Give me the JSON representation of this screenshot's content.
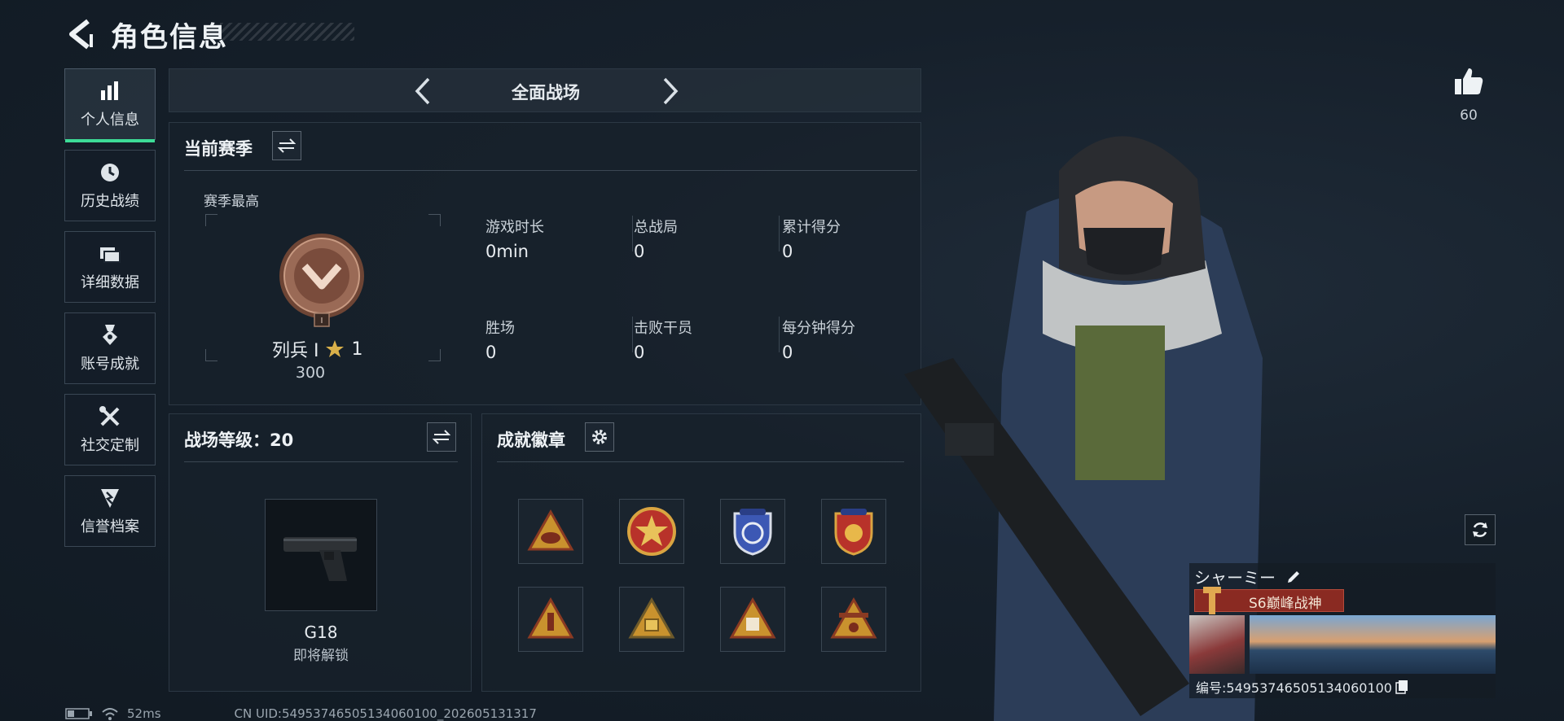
{
  "header": {
    "title": "角色信息"
  },
  "sidebar": {
    "items": [
      {
        "label": "个人信息",
        "icon": "bar-chart-icon",
        "active": true
      },
      {
        "label": "历史战绩",
        "icon": "history-icon",
        "active": false
      },
      {
        "label": "详细数据",
        "icon": "folder-icon",
        "active": false
      },
      {
        "label": "账号成就",
        "icon": "medal-icon",
        "active": false
      },
      {
        "label": "社交定制",
        "icon": "tools-icon",
        "active": false
      },
      {
        "label": "信誉档案",
        "icon": "shield-icon",
        "active": false
      }
    ]
  },
  "mode_selector": {
    "label": "全面战场"
  },
  "season": {
    "title": "当前赛季",
    "best_label": "赛季最高",
    "rank_name": "列兵 Ⅰ",
    "stars": "1",
    "rank_points": "300",
    "rank_sub": "I",
    "stats": [
      {
        "label": "游戏时长",
        "value": "0min"
      },
      {
        "label": "总战局",
        "value": "0"
      },
      {
        "label": "累计得分",
        "value": "0"
      },
      {
        "label": "胜场",
        "value": "0"
      },
      {
        "label": "击败干员",
        "value": "0"
      },
      {
        "label": "每分钟得分",
        "value": "0"
      }
    ]
  },
  "battle_level": {
    "title": "战场等级：20",
    "weapon_name": "G18",
    "weapon_status": "即将解锁"
  },
  "achievements": {
    "title": "成就徽章",
    "badges": [
      "badge-triangle-helmet",
      "badge-star-seal",
      "badge-shield-blue",
      "badge-shield-red",
      "badge-triangle-rocket",
      "badge-triangle-gold",
      "badge-triangle-s8",
      "badge-triangle-crest"
    ]
  },
  "likes": {
    "count": "60"
  },
  "player": {
    "name": "シャーミー",
    "title_badge": "S6巅峰战神",
    "id_label": "编号:549537465051340601​00"
  },
  "footer": {
    "ping": "52ms",
    "uid": "CN UID:5495374650513406​0100_202605131317"
  },
  "colors": {
    "accent": "#3ddc97",
    "title_bar": "#8a2a22",
    "bronze": "#8a5a48"
  }
}
